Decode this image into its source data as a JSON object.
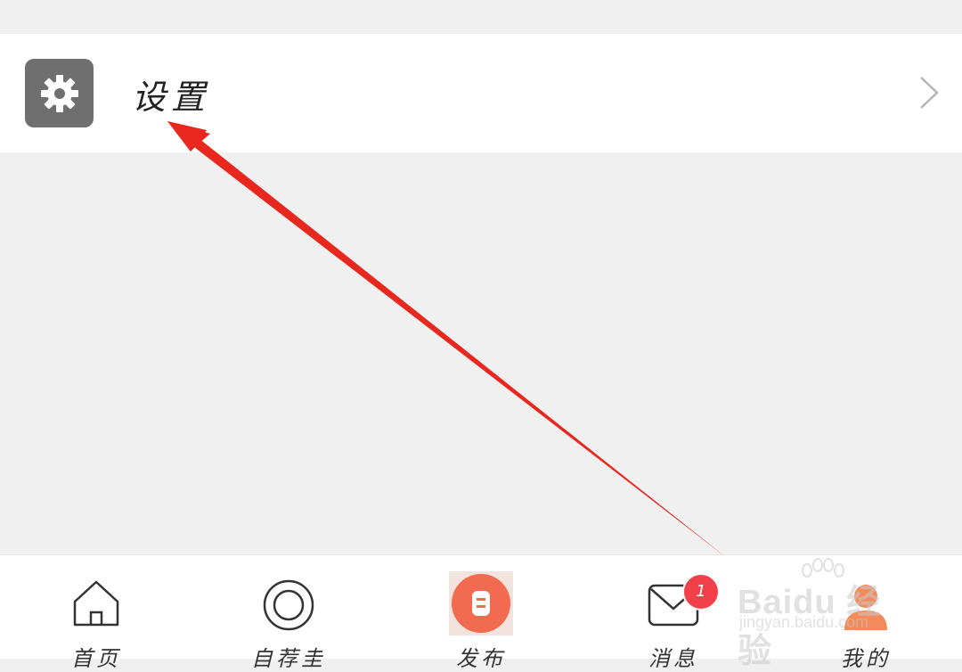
{
  "settings": {
    "label": "设置",
    "icon": "gear-icon"
  },
  "tabbar": {
    "tabs": [
      {
        "label": "首页",
        "icon": "home-icon"
      },
      {
        "label": "自荐圭",
        "icon": "ring-icon"
      },
      {
        "label": "发布",
        "icon": "publish-icon"
      },
      {
        "label": "消息",
        "icon": "mail-icon"
      },
      {
        "label": "我的",
        "icon": "profile-icon"
      }
    ],
    "message_badge": "1"
  },
  "watermark": {
    "brand": "Baidu 经验",
    "url": "jingyan.baidu.com"
  },
  "colors": {
    "arrow": "#e8281e",
    "badge": "#f2404a",
    "publish": "#f26a4f",
    "icon_bg": "#6f6f6f"
  }
}
